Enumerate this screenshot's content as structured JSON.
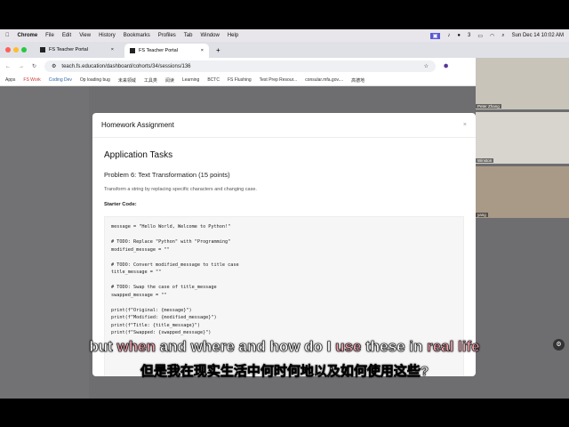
{
  "menubar": {
    "app": "Chrome",
    "items": [
      "File",
      "Edit",
      "View",
      "History",
      "Bookmarks",
      "Profiles",
      "Tab",
      "Window",
      "Help"
    ],
    "badge": "3",
    "clock": "Sun Dec 14  10:02 AM"
  },
  "tabs": [
    {
      "title": "FS Teacher Portal"
    },
    {
      "title": "FS Teacher Portal"
    }
  ],
  "address": {
    "url": "teach.fs.education/dashboard/cohorts/34/sessions/136"
  },
  "bookmarks": [
    "Apps",
    "FS Work",
    "Coding Dev",
    "Op loading bug",
    "未来领域",
    "工具类",
    "阅读",
    "Learning",
    "BCTC",
    "FS Flushing",
    "Test Prep Resour...",
    "consular.mfa.gov....",
    "高德地"
  ],
  "modal": {
    "title": "Homework Assignment",
    "close": "×",
    "section": "Application Tasks",
    "problem": "Problem 6: Text Transformation (15 points)",
    "description": "Transform a string by replacing specific characters and changing case.",
    "starter_label": "Starter Code:",
    "code": "message = \"Hello World, Welcome to Python!\"\n\n# TODO: Replace \"Python\" with \"Programming\"\nmodified_message = \"\"\n\n# TODO: Convert modified_message to title case\ntitle_message = \"\"\n\n# TODO: Swap the case of title_message\nswapped_message = \"\"\n\nprint(f\"Original: {message}\")\nprint(f\"Modified: {modified_message}\")\nprint(f\"Title: {title_message}\")\nprint(f\"Swapped: {swapped_message}\")"
  },
  "participants": [
    {
      "name": "Peter Zhang"
    },
    {
      "name": "Winston"
    },
    {
      "name": "yang"
    }
  ],
  "subtitles": {
    "en_1": "but ",
    "en_hl1": "when",
    "en_2": " and where and how do I ",
    "en_hl2": "use",
    "en_3": " these in ",
    "en_hl3": "real life",
    "zh": "但是我在现实生活中何时何地以及如何使用这些?"
  }
}
